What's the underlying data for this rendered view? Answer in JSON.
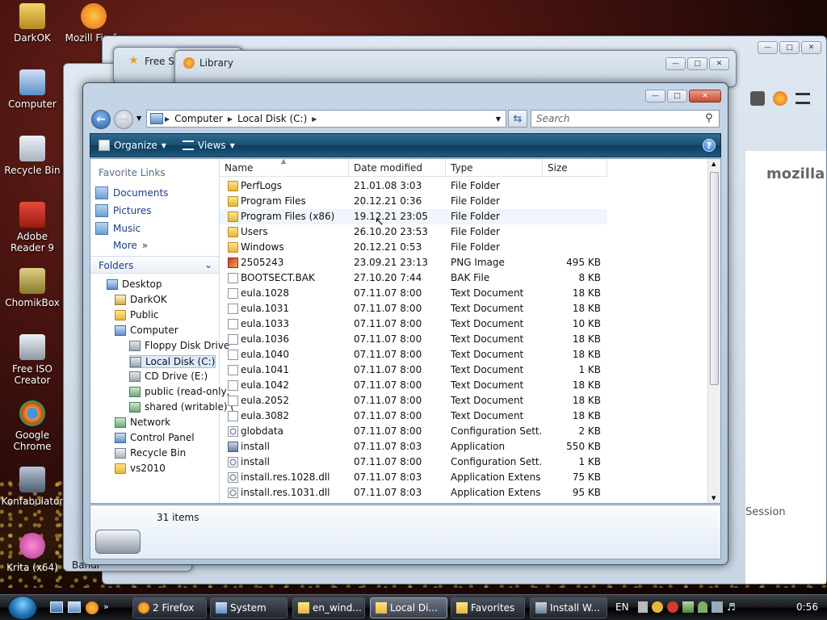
{
  "desktop_icons": [
    {
      "label": "DarkOK"
    },
    {
      "label": "Mozill Firefo"
    },
    {
      "label": "Computer"
    },
    {
      "label": "Recycle Bin"
    },
    {
      "label": "Adobe Reader 9"
    },
    {
      "label": "ChomikBox"
    },
    {
      "label": "Free ISO Creator"
    },
    {
      "label": "Google Chrome"
    },
    {
      "label": "Konfabulator"
    },
    {
      "label": "Krita (x64)"
    }
  ],
  "bg_windows": {
    "library_title": "Library",
    "firefox_title_fragment": "Free Sc",
    "mozilla_text": "mozilla",
    "session_text": "Session",
    "bandi_text": "Bandi"
  },
  "explorer": {
    "breadcrumb": [
      "Computer",
      "Local Disk (C:)"
    ],
    "search_placeholder": "Search",
    "toolbar": {
      "organize": "Organize",
      "views": "Views",
      "help": "?"
    },
    "favorite_links_header": "Favorite Links",
    "favorite_links": [
      "Documents",
      "Pictures",
      "Music"
    ],
    "more_label": "More",
    "folders_header": "Folders",
    "tree": [
      {
        "label": "Desktop",
        "level": 0,
        "icon": "sys"
      },
      {
        "label": "DarkOK",
        "level": 1,
        "icon": "user"
      },
      {
        "label": "Public",
        "level": 1,
        "icon": "folder"
      },
      {
        "label": "Computer",
        "level": 1,
        "icon": "sys"
      },
      {
        "label": "Floppy Disk Drive",
        "level": 2,
        "icon": "drive"
      },
      {
        "label": "Local Disk (C:)",
        "level": 2,
        "icon": "drive",
        "selected": true
      },
      {
        "label": "CD Drive (E:)",
        "level": 2,
        "icon": "drive"
      },
      {
        "label": "public (read-only,",
        "level": 2,
        "icon": "net"
      },
      {
        "label": "shared (writable) (",
        "level": 2,
        "icon": "net"
      },
      {
        "label": "Network",
        "level": 1,
        "icon": "net"
      },
      {
        "label": "Control Panel",
        "level": 1,
        "icon": "sys"
      },
      {
        "label": "Recycle Bin",
        "level": 1,
        "icon": "bin"
      },
      {
        "label": "vs2010",
        "level": 1,
        "icon": "folder"
      }
    ],
    "columns": {
      "name": "Name",
      "date": "Date modified",
      "type": "Type",
      "size": "Size"
    },
    "files": [
      {
        "name": "PerfLogs",
        "date": "21.01.08 3:03",
        "type": "File Folder",
        "size": "",
        "icon": "folder"
      },
      {
        "name": "Program Files",
        "date": "20.12.21 0:36",
        "type": "File Folder",
        "size": "",
        "icon": "folder"
      },
      {
        "name": "Program Files (x86)",
        "date": "19.12.21 23:05",
        "type": "File Folder",
        "size": "",
        "icon": "folder"
      },
      {
        "name": "Users",
        "date": "26.10.20 23:53",
        "type": "File Folder",
        "size": "",
        "icon": "folder"
      },
      {
        "name": "Windows",
        "date": "20.12.21 0:53",
        "type": "File Folder",
        "size": "",
        "icon": "folder"
      },
      {
        "name": "2505243",
        "date": "23.09.21 23:13",
        "type": "PNG Image",
        "size": "495 KB",
        "icon": "png"
      },
      {
        "name": "BOOTSECT.BAK",
        "date": "27.10.20 7:44",
        "type": "BAK File",
        "size": "8 KB",
        "icon": "doc"
      },
      {
        "name": "eula.1028",
        "date": "07.11.07 8:00",
        "type": "Text Document",
        "size": "18 KB",
        "icon": "doc"
      },
      {
        "name": "eula.1031",
        "date": "07.11.07 8:00",
        "type": "Text Document",
        "size": "18 KB",
        "icon": "doc"
      },
      {
        "name": "eula.1033",
        "date": "07.11.07 8:00",
        "type": "Text Document",
        "size": "10 KB",
        "icon": "doc"
      },
      {
        "name": "eula.1036",
        "date": "07.11.07 8:00",
        "type": "Text Document",
        "size": "18 KB",
        "icon": "doc"
      },
      {
        "name": "eula.1040",
        "date": "07.11.07 8:00",
        "type": "Text Document",
        "size": "18 KB",
        "icon": "doc"
      },
      {
        "name": "eula.1041",
        "date": "07.11.07 8:00",
        "type": "Text Document",
        "size": "1 KB",
        "icon": "doc"
      },
      {
        "name": "eula.1042",
        "date": "07.11.07 8:00",
        "type": "Text Document",
        "size": "18 KB",
        "icon": "doc"
      },
      {
        "name": "eula.2052",
        "date": "07.11.07 8:00",
        "type": "Text Document",
        "size": "18 KB",
        "icon": "doc"
      },
      {
        "name": "eula.3082",
        "date": "07.11.07 8:00",
        "type": "Text Document",
        "size": "18 KB",
        "icon": "doc"
      },
      {
        "name": "globdata",
        "date": "07.11.07 8:00",
        "type": "Configuration Sett...",
        "size": "2 KB",
        "icon": "cfg"
      },
      {
        "name": "install",
        "date": "07.11.07 8:03",
        "type": "Application",
        "size": "550 KB",
        "icon": "app"
      },
      {
        "name": "install",
        "date": "07.11.07 8:00",
        "type": "Configuration Sett...",
        "size": "1 KB",
        "icon": "cfg"
      },
      {
        "name": "install.res.1028.dll",
        "date": "07.11.07 8:03",
        "type": "Application Extens...",
        "size": "75 KB",
        "icon": "cfg"
      },
      {
        "name": "install.res.1031.dll",
        "date": "07.11.07 8:03",
        "type": "Application Extens...",
        "size": "95 KB",
        "icon": "cfg"
      }
    ],
    "item_count": "31 items"
  },
  "taskbar": {
    "tasks": [
      {
        "label": "2 Firefox",
        "icon": "firefox"
      },
      {
        "label": "System",
        "icon": "sys"
      },
      {
        "label": "en_wind...",
        "icon": "folder"
      },
      {
        "label": "Local Di...",
        "icon": "folder",
        "active": true
      },
      {
        "label": "Favorites",
        "icon": "folder"
      },
      {
        "label": "Install W...",
        "icon": "app"
      }
    ],
    "language": "EN",
    "clock": "0:56"
  }
}
